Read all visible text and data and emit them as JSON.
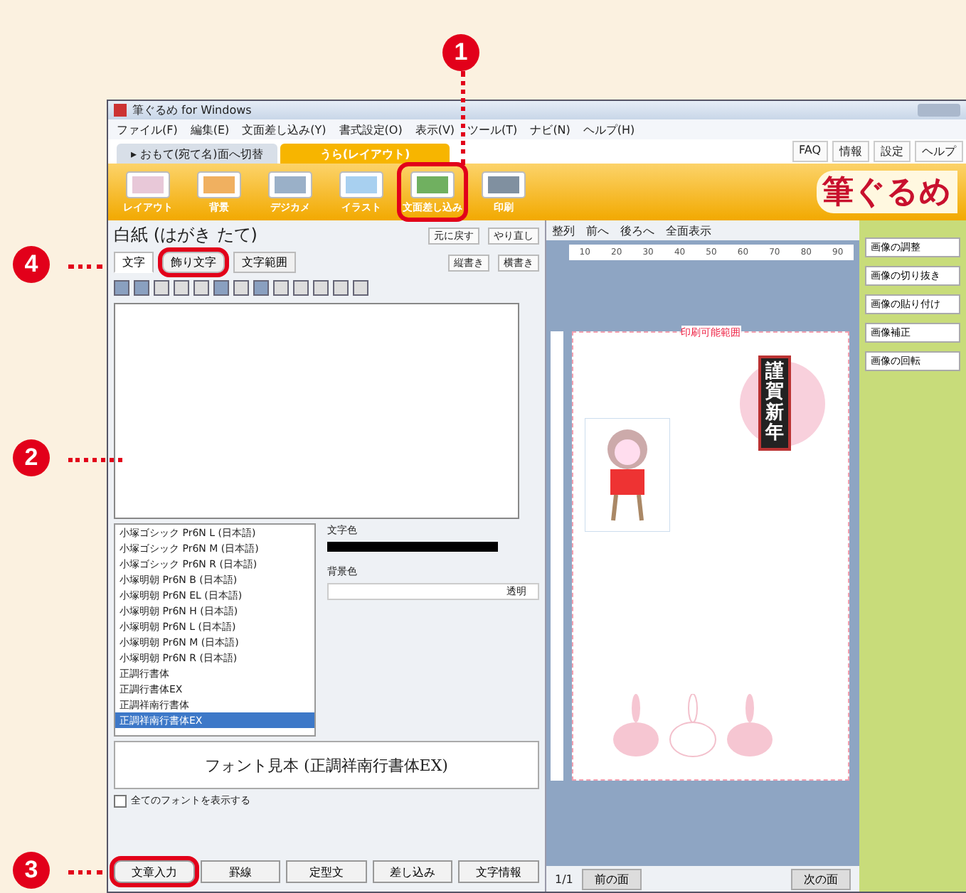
{
  "callouts": [
    "1",
    "4",
    "2",
    "3"
  ],
  "window": {
    "title": "筆ぐるめ for Windows"
  },
  "menu": [
    "ファイル(F)",
    "編集(E)",
    "文面差し込み(Y)",
    "書式設定(O)",
    "表示(V)",
    "ツール(T)",
    "ナビ(N)",
    "ヘルプ(H)"
  ],
  "mode_tabs": [
    {
      "label": "▸ おもて(宛て名)面へ切替",
      "selected": false
    },
    {
      "label": "うら(レイアウト)",
      "selected": true
    }
  ],
  "help_buttons": [
    "FAQ",
    "情報",
    "設定",
    "ヘルプ"
  ],
  "tools": [
    {
      "label": "レイアウト",
      "ringed": false
    },
    {
      "label": "背景",
      "ringed": false
    },
    {
      "label": "デジカメ",
      "ringed": false
    },
    {
      "label": "イラスト",
      "ringed": false
    },
    {
      "label": "文面差し込み",
      "ringed": true
    },
    {
      "label": "印刷",
      "ringed": false
    }
  ],
  "logo": "筆ぐるめ",
  "panel": {
    "title": "白紙 (はがき たて)",
    "undo": "元に戻す",
    "redo": "やり直し",
    "text_tabs": [
      {
        "label": "文字",
        "selected": true,
        "ringed": false
      },
      {
        "label": "飾り文字",
        "selected": false,
        "ringed": true
      },
      {
        "label": "文字範囲",
        "selected": false,
        "ringed": false
      }
    ],
    "direction": [
      "縦書き",
      "横書き"
    ],
    "fonts": [
      {
        "name": "小塚ゴシック Pr6N L (日本語)",
        "selected": false
      },
      {
        "name": "小塚ゴシック Pr6N M (日本語)",
        "selected": false
      },
      {
        "name": "小塚ゴシック Pr6N R (日本語)",
        "selected": false
      },
      {
        "name": "小塚明朝 Pr6N B (日本語)",
        "selected": false
      },
      {
        "name": "小塚明朝 Pr6N EL (日本語)",
        "selected": false
      },
      {
        "name": "小塚明朝 Pr6N H (日本語)",
        "selected": false
      },
      {
        "name": "小塚明朝 Pr6N L (日本語)",
        "selected": false
      },
      {
        "name": "小塚明朝 Pr6N M (日本語)",
        "selected": false
      },
      {
        "name": "小塚明朝 Pr6N R (日本語)",
        "selected": false
      },
      {
        "name": "正調行書体",
        "selected": false
      },
      {
        "name": "正調行書体EX",
        "selected": false
      },
      {
        "name": "正調祥南行書体",
        "selected": false
      },
      {
        "name": "正調祥南行書体EX",
        "selected": true
      }
    ],
    "text_color_label": "文字色",
    "bg_color_label": "背景色",
    "bg_color_value": "透明",
    "sample": "フォント見本 (正調祥南行書体EX)",
    "show_all_fonts": {
      "label": "全てのフォントを表示する",
      "checked": false
    },
    "bottom_buttons": [
      {
        "label": "文章入力",
        "ringed": true
      },
      {
        "label": "罫線",
        "ringed": false
      },
      {
        "label": "定型文",
        "ringed": false
      },
      {
        "label": "差し込み",
        "ringed": false
      },
      {
        "label": "文字情報",
        "ringed": false
      }
    ]
  },
  "canvas": {
    "toolbar": [
      "整列",
      "前へ",
      "後ろへ",
      "全面表示"
    ],
    "ruler": [
      "10",
      "20",
      "30",
      "40",
      "50",
      "60",
      "70",
      "80",
      "90"
    ],
    "printable_label": "印刷可能範囲",
    "greeting": "謹賀新年",
    "page": "1/1",
    "prev": "前の面",
    "next": "次の面"
  },
  "side_buttons": [
    "画像の調整",
    "画像の切り抜き",
    "画像の貼り付け",
    "画像補正",
    "画像の回転"
  ]
}
